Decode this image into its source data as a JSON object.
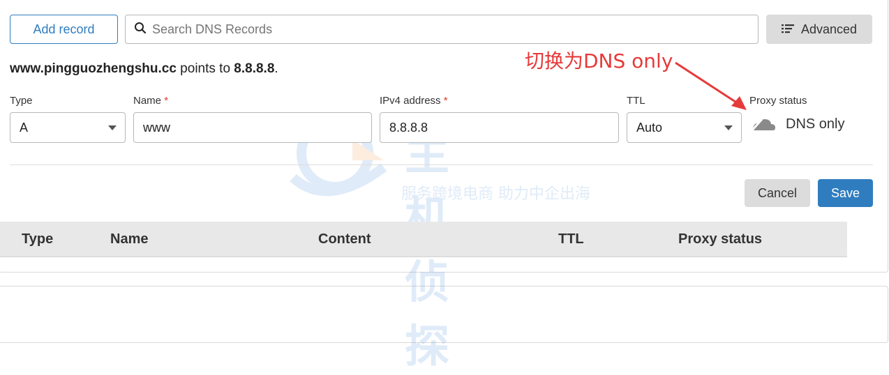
{
  "toolbar": {
    "add_record_label": "Add record",
    "search_placeholder": "Search DNS Records",
    "advanced_label": "Advanced"
  },
  "info": {
    "domain": "www.pingguozhengshu.cc",
    "middle": " points to ",
    "target": "8.8.8.8",
    "end": "."
  },
  "annotation": "切换为DNS only",
  "form": {
    "type_label": "Type",
    "type_value": "A",
    "name_label": "Name",
    "name_value": "www",
    "ipv4_label": "IPv4 address",
    "ipv4_value": "8.8.8.8",
    "ttl_label": "TTL",
    "ttl_value": "Auto",
    "proxy_label": "Proxy status",
    "proxy_value": "DNS only",
    "required_mark": "*"
  },
  "actions": {
    "cancel_label": "Cancel",
    "save_label": "Save"
  },
  "table": {
    "headers": [
      "Type",
      "Name",
      "Content",
      "TTL",
      "Proxy status"
    ]
  },
  "watermark": {
    "title": "主机侦探",
    "slogan": "服务跨境电商 助力中企出海"
  },
  "colors": {
    "accent": "#2f7dbf",
    "annotation": "#e63a3a"
  }
}
